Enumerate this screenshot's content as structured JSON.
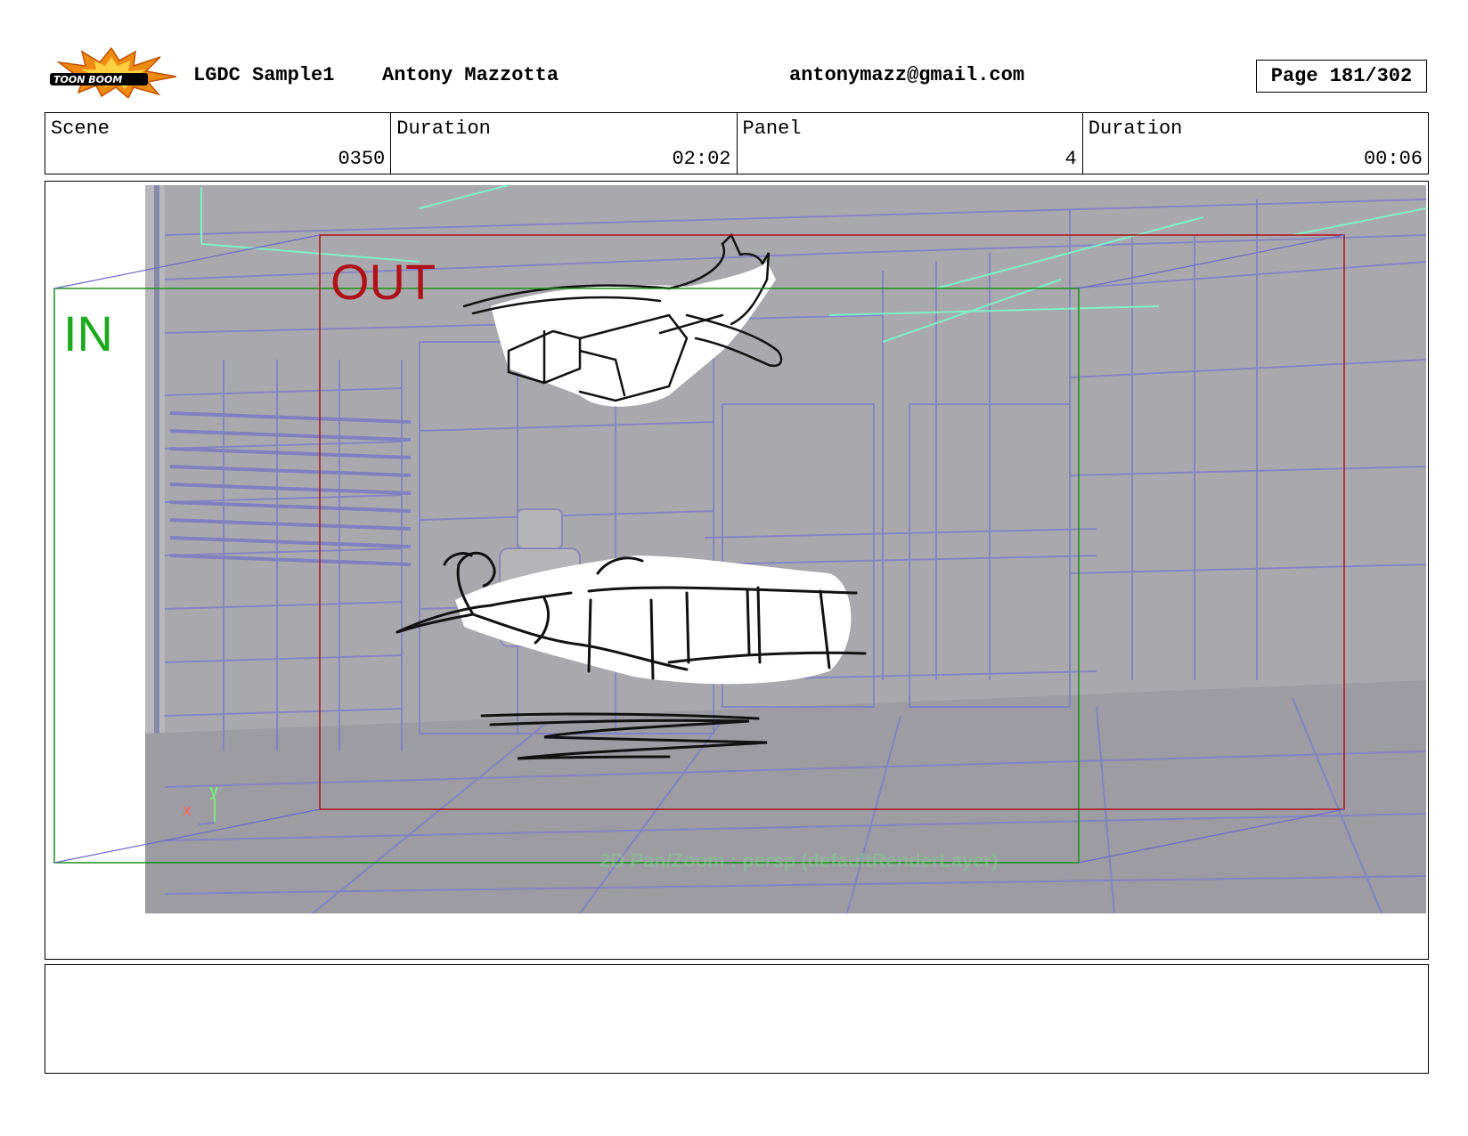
{
  "header": {
    "logo_text": "TOON BOOM",
    "project": "LGDC Sample1",
    "author": "Antony Mazzotta",
    "email": "antonymazz@gmail.com",
    "page": "Page 181/302"
  },
  "info": {
    "scene_label": "Scene",
    "scene_value": "0350",
    "scene_duration_label": "Duration",
    "scene_duration_value": "02:02",
    "panel_label": "Panel",
    "panel_value": "4",
    "panel_duration_label": "Duration",
    "panel_duration_value": "00:06"
  },
  "panel": {
    "in_label": "IN",
    "out_label": "OUT",
    "axis_y": "y",
    "axis_x": "x",
    "viewport_caption": "2D Pan/Zoom : persp (defaultRenderLayer)",
    "colors": {
      "in_frame": "#1a8f1a",
      "out_frame": "#b01018",
      "background": "#a9a9ad",
      "wireframe": "#7f7fc8",
      "grid_lines": "#7ff0c8"
    }
  },
  "notes": {
    "text": ""
  }
}
